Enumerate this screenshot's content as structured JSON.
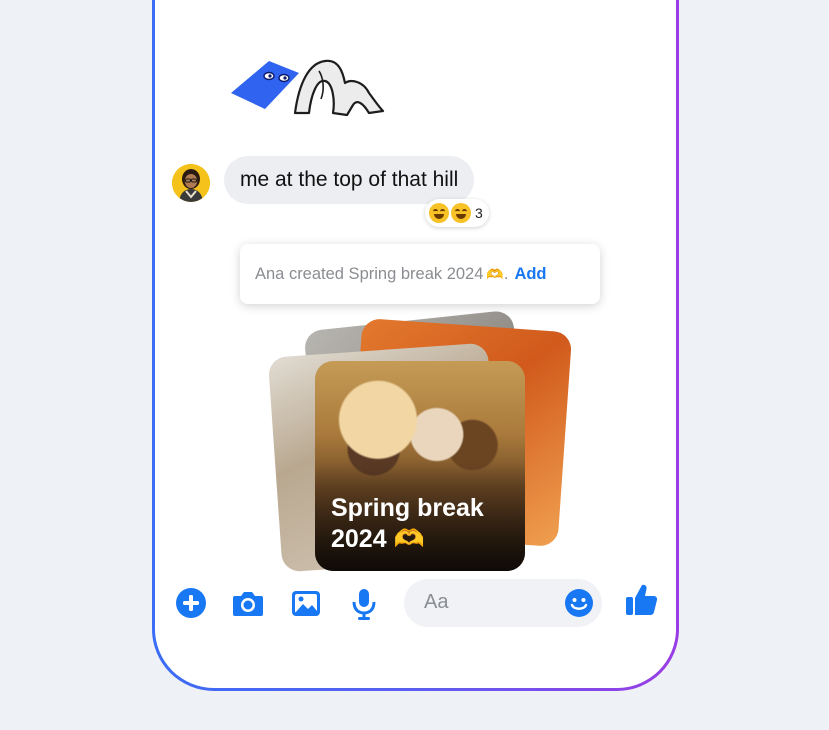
{
  "conversation": {
    "message": {
      "text": "me at the top of that hill",
      "reaction_count": "3"
    },
    "notice": {
      "text": "Ana created Spring break 2024",
      "action": "Add",
      "emoji": "🫶"
    },
    "album": {
      "title_line1": "Spring break",
      "title_line2": "2024 🫶"
    }
  },
  "composer": {
    "placeholder": "Aa"
  },
  "colors": {
    "accent": "#1877f2",
    "bubble": "#eceef2",
    "frame_left": "#3a6cf5",
    "frame_right": "#9a3ce6"
  }
}
